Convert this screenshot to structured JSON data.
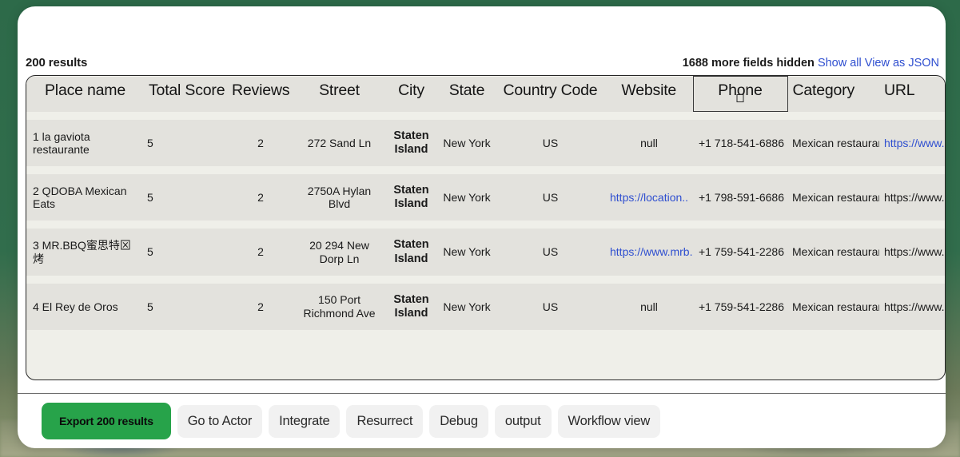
{
  "header": {
    "results_count": "200 results",
    "fields_hidden": "1688 more fields hidden",
    "show_all_label": "Show all",
    "view_as_json_label": "View as JSON"
  },
  "table": {
    "columns": [
      "Place name",
      "Total Score",
      "Reviews",
      "Street",
      "City",
      "State",
      "Country Code",
      "Website",
      "Phone",
      "Category",
      "URL"
    ],
    "selected_column": "Phone",
    "rows": [
      {
        "index": "1",
        "place_name": "la gaviota restaurante",
        "total_score": "5",
        "reviews": "2",
        "street": "272 Sand Ln",
        "city": "Staten Island",
        "state": "New York",
        "country_code": "US",
        "website": "null",
        "website_is_link": false,
        "phone": "+1 718-541-6886",
        "category": "Mexican restaurant",
        "url": "https://www.g......",
        "url_is_link": true
      },
      {
        "index": "2",
        "place_name": "QDOBA Mexican Eats",
        "total_score": "5",
        "reviews": "2",
        "street": "2750A Hylan Blvd",
        "city": "Staten Island",
        "state": "New York",
        "country_code": "US",
        "website": "https://location..",
        "website_is_link": true,
        "phone": "+1 798-591-6686",
        "category": "Mexican restaurant",
        "url": "https://www.g...",
        "url_is_link": false
      },
      {
        "index": "3",
        "place_name": "MR.BBQ蜜思特⊠烤",
        "total_score": "5",
        "reviews": "2",
        "street": "20 294 New Dorp Ln",
        "city": "Staten Island",
        "state": "New York",
        "country_code": "US",
        "website": "https://www.mrb..",
        "website_is_link": true,
        "phone": "+1 759-541-2286",
        "category": "Mexican restaurant",
        "url": "https://www.g...",
        "url_is_link": false
      },
      {
        "index": "4",
        "place_name": "El Rey de Oros",
        "total_score": "5",
        "reviews": "2",
        "street": "150 Port Richmond Ave",
        "city": "Staten Island",
        "state": "New York",
        "country_code": "US",
        "website": "null",
        "website_is_link": false,
        "phone": "+1 759-541-2286",
        "category": "Mexican restaurant",
        "url": "https://www.g...",
        "url_is_link": false
      }
    ]
  },
  "footer": {
    "export_label": "Export 200 results",
    "buttons": [
      "Go to Actor",
      "Integrate",
      "Resurrect",
      "Debug",
      "output",
      "Workflow view"
    ]
  },
  "colors": {
    "accent_green": "#27a34a",
    "link_blue": "#2f4fd0",
    "page_backdrop": "#2f6b4a",
    "row_band": "#e3e2dd",
    "row_gap": "#efefe9"
  }
}
